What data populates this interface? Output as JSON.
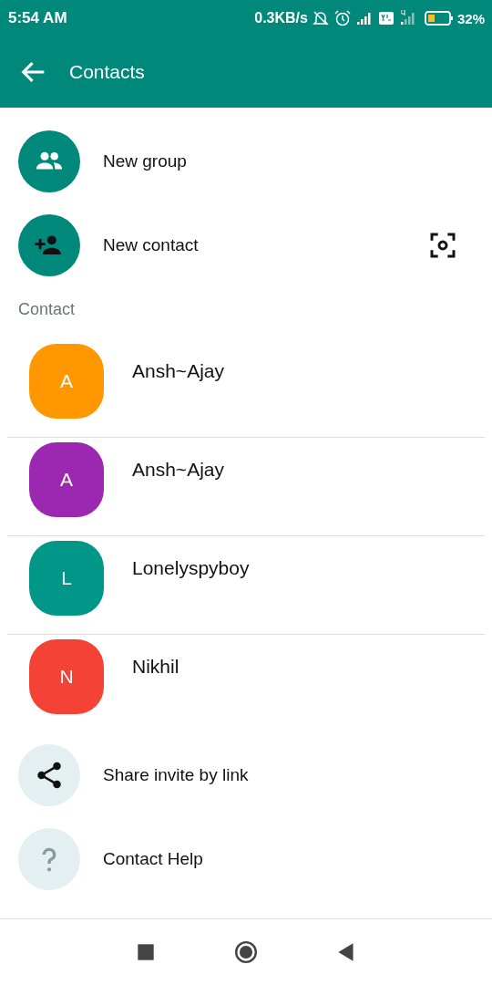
{
  "status_bar": {
    "time": "5:54 AM",
    "speed": "0.3KB/s",
    "battery": "32%"
  },
  "app_bar": {
    "title": "Contacts"
  },
  "actions": [
    {
      "kind": "group",
      "label": "New group"
    },
    {
      "kind": "contact",
      "label": "New contact"
    }
  ],
  "section": "Contact",
  "contacts": [
    {
      "initial": "A",
      "name": "Ansh~Ajay",
      "color": "#ff9800"
    },
    {
      "initial": "A",
      "name": "Ansh~Ajay",
      "color": "#9c27b0"
    },
    {
      "initial": "L",
      "name": "Lonelyspyboy",
      "color": "#009688"
    },
    {
      "initial": "N",
      "name": "Nikhil",
      "color": "#f44336"
    }
  ],
  "footer_actions": [
    {
      "kind": "share",
      "label": "Share invite by link"
    },
    {
      "kind": "help",
      "label": "Contact Help"
    }
  ]
}
